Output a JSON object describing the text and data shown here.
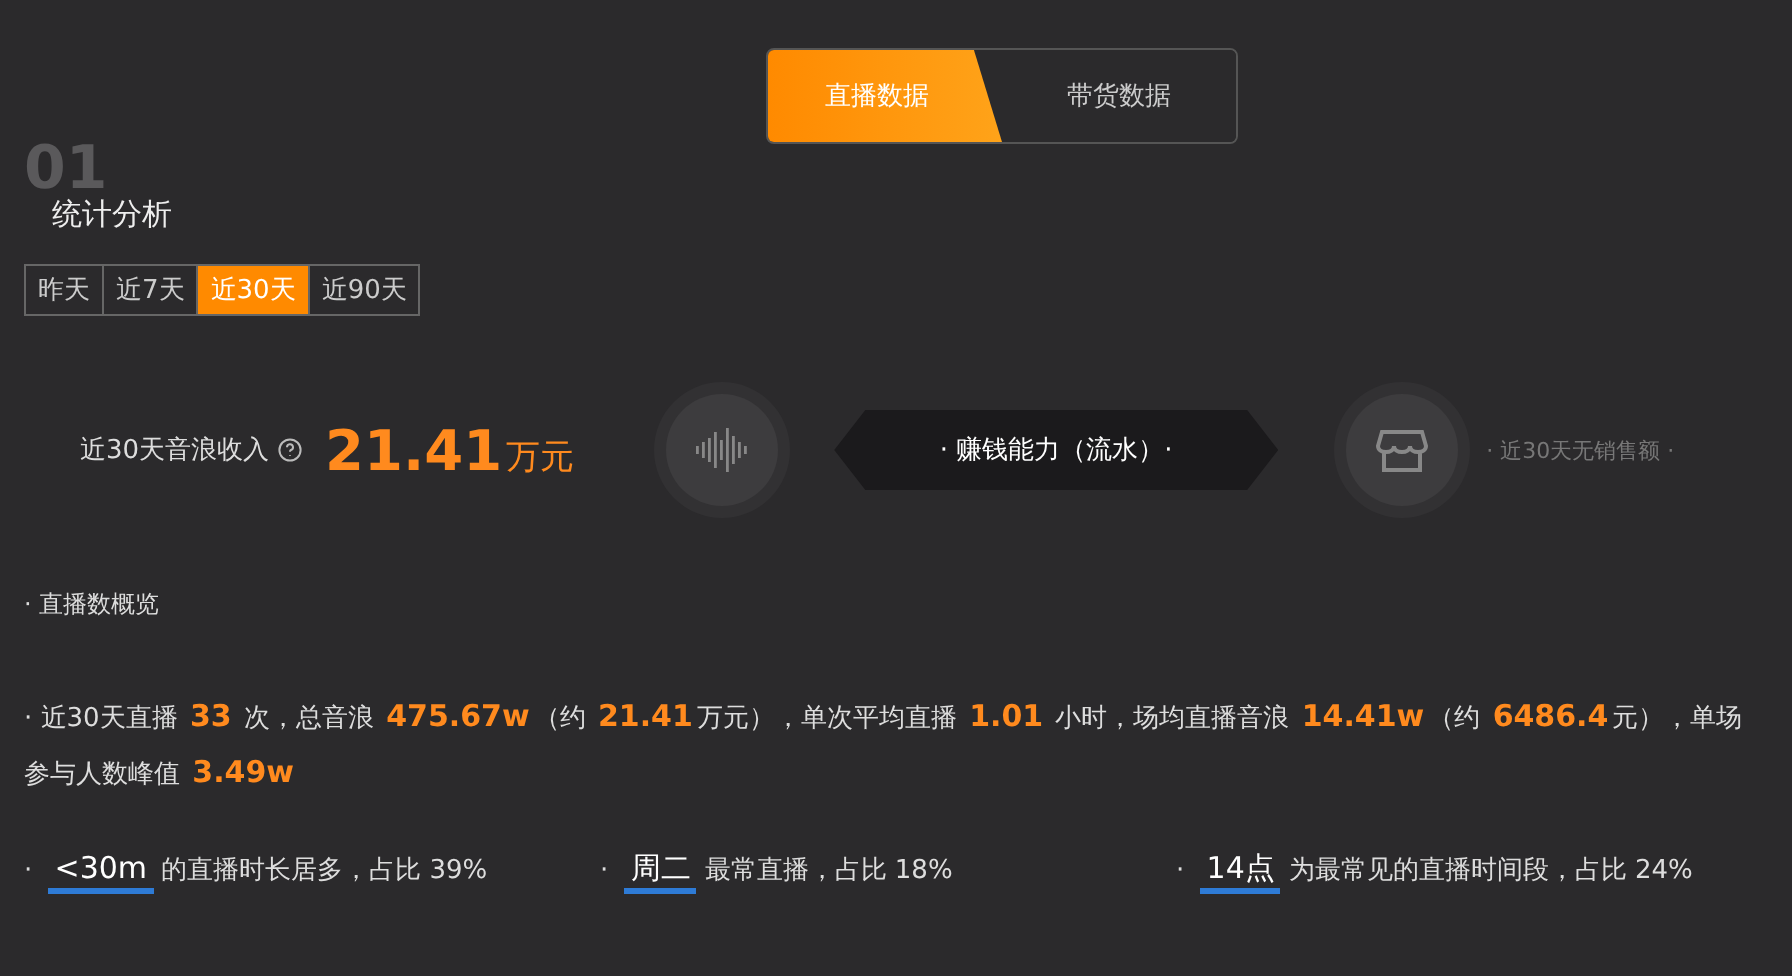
{
  "mode_tabs": [
    {
      "label": "直播数据",
      "selected": true
    },
    {
      "label": "带货数据",
      "selected": false
    }
  ],
  "section": {
    "number": "01",
    "title": "统计分析"
  },
  "range_tabs": [
    {
      "label": "昨天",
      "selected": false
    },
    {
      "label": "近7天",
      "selected": false
    },
    {
      "label": "近30天",
      "selected": true
    },
    {
      "label": "近90天",
      "selected": false
    }
  ],
  "income": {
    "label": "近30天音浪收入",
    "value": "21.41",
    "unit": "万元"
  },
  "earning_banner": "· 赚钱能力（流水）·",
  "sales_note": "· 近30天无销售额 ·",
  "overview_title": "· 直播数概览",
  "overview": [
    {
      "text": "· 近30天直播 ",
      "emphasis": false
    },
    {
      "text": "33",
      "emphasis": true
    },
    {
      "text": " 次，总音浪 ",
      "emphasis": false
    },
    {
      "text": "475.67w",
      "emphasis": true
    },
    {
      "text": "（约 ",
      "emphasis": false
    },
    {
      "text": "21.41",
      "emphasis": true
    },
    {
      "text": "万元），单次平均直播 ",
      "emphasis": false
    },
    {
      "text": "1.01",
      "emphasis": true
    },
    {
      "text": " 小时，场均直播音浪 ",
      "emphasis": false
    },
    {
      "text": "14.41w",
      "emphasis": true
    },
    {
      "text": "（约 ",
      "emphasis": false
    },
    {
      "text": "6486.4",
      "emphasis": true
    },
    {
      "text": "元），单场参与人数峰值 ",
      "emphasis": false
    },
    {
      "text": "3.49w",
      "emphasis": true
    }
  ],
  "facts": [
    {
      "marker": "·",
      "key": "<30m",
      "text": "的直播时长居多，占比 39%"
    },
    {
      "marker": "·",
      "key": "周二",
      "text": "最常直播，占比 18%"
    },
    {
      "marker": "·",
      "key": "14点",
      "text": "为最常见的直播时间段，占比 24%"
    }
  ]
}
